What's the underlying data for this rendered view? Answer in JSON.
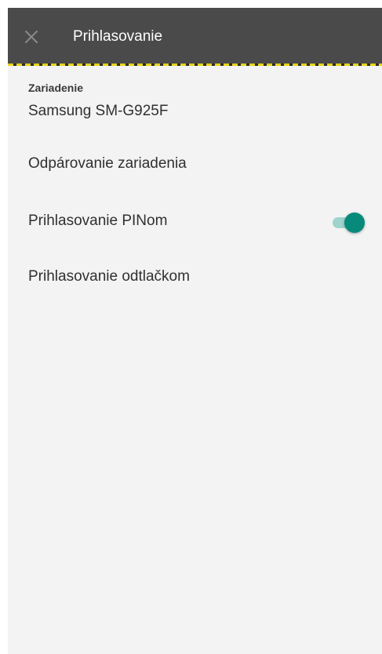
{
  "app_bar": {
    "title": "Prihlasovanie",
    "close_icon": "close-icon",
    "background_color": "#4a4a4a"
  },
  "device": {
    "section_label": "Zariadenie",
    "name": "Samsung SM-G925F"
  },
  "settings": [
    {
      "label": "Odpárovanie zariadenia"
    },
    {
      "label": "Prihlasovanie PINom",
      "toggle": true,
      "toggle_on": true
    },
    {
      "label": "Prihlasovanie odtlačkom"
    }
  ],
  "colors": {
    "accent": "#078a7a",
    "toggle_track": "#9fd3cd",
    "background": "#f3f3f3"
  }
}
